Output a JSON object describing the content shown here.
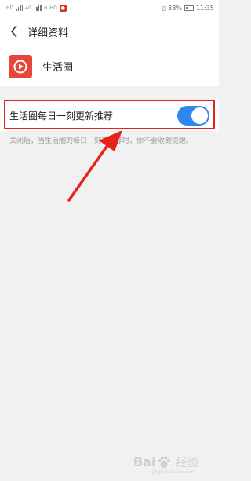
{
  "status_bar": {
    "battery_text": "33%",
    "time": "11:35",
    "left_chips": [
      "HD",
      "4G",
      "HD"
    ]
  },
  "header": {
    "title": "详细资料",
    "back_icon": "chevron-left-icon"
  },
  "app": {
    "name": "生活圈",
    "icon": "play-icon",
    "icon_color": "#e8463d"
  },
  "setting": {
    "label": "生活圈每日一刻更新推荐",
    "toggle_state": true,
    "toggle_color": "#2d89ef"
  },
  "note": "关闭后，当生活圈的每日一刻有推荐时，你不会收到提醒。",
  "annotations": {
    "highlight_color": "#e8211d",
    "arrow_color": "#e8211d"
  },
  "watermark": {
    "brand_left": "Bai",
    "brand_right": "经验",
    "url": "jingyan.baidu.com"
  }
}
